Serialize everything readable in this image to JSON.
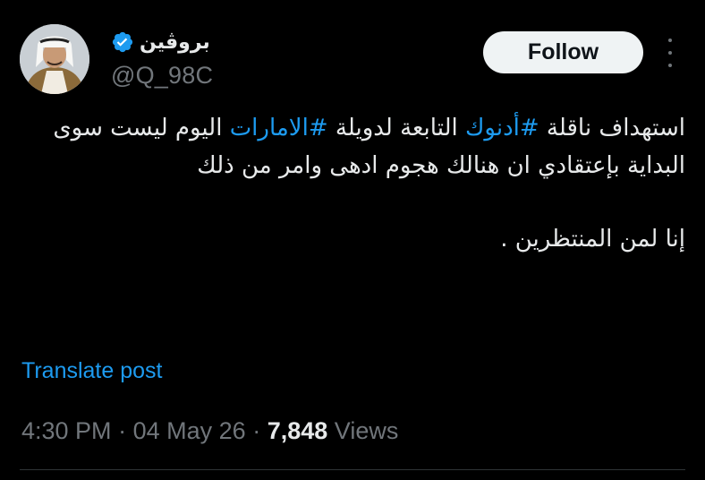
{
  "author": {
    "display_name": "بروڤين",
    "handle": "@Q_98C",
    "verified": true
  },
  "follow_label": "Follow",
  "post": {
    "line1_pre": "استهداف ناقلة ",
    "hashtag1": "#أدنوك",
    "line1_mid": " التابعة لدويلة ",
    "hashtag2": "#الامارات",
    "line1_post": " اليوم ليست سوى البداية بإعتقادي ان هنالك هجوم ادهى وامر من ذلك",
    "line2": "إنا لمن المنتظرين ."
  },
  "translate_label": "Translate post",
  "meta": {
    "time": "4:30 PM",
    "separator": "·",
    "date": "04 May 26",
    "views_count": "7,848",
    "views_label": "Views"
  },
  "colors": {
    "background": "#000000",
    "link": "#1d9bf0",
    "muted": "#71767b",
    "text": "#e7e9ea"
  },
  "icons": {
    "verified": "verified-badge-icon",
    "more": "more-vertical-icon"
  }
}
